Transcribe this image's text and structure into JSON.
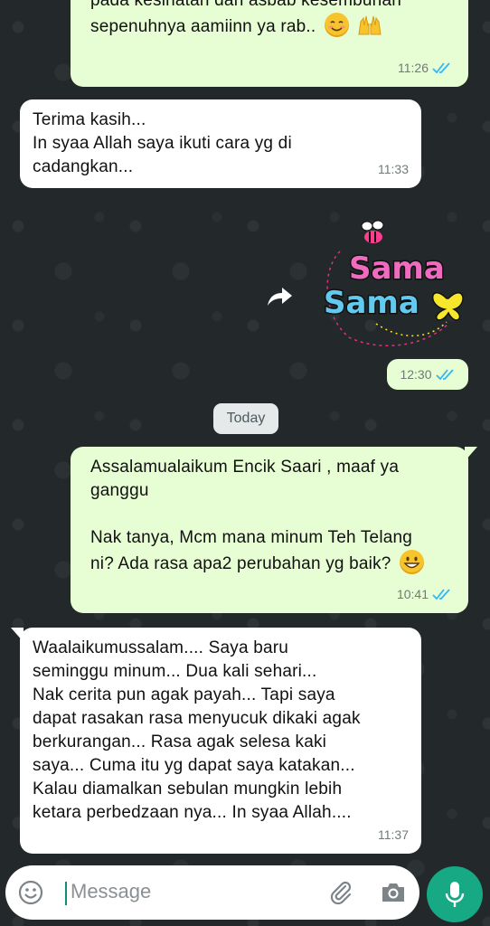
{
  "messages": [
    {
      "direction": "outgoing",
      "text": "pada kesihatan dan asbab kesembuhan\nsepenuhnya aamiinn ya rab..",
      "emoji": [
        "smiling-face-icon",
        "raising-hands-icon"
      ],
      "time": "11:26",
      "status": "read"
    },
    {
      "direction": "incoming",
      "text": "Terima kasih...\nIn syaa Allah saya ikuti cara yg di\ncadangkan...",
      "time": "11:33"
    },
    {
      "direction": "outgoing",
      "type": "sticker",
      "sticker_text_line1": "Sama",
      "sticker_text_line2": "Sama",
      "time": "12:30",
      "status": "read"
    },
    {
      "direction": "outgoing",
      "text": "Assalamualaikum Encik Saari , maaf ya\nganggu\n\nNak tanya, Mcm mana minum Teh Telang\nni? Ada rasa apa2 perubahan yg baik?",
      "emoji": [
        "grinning-face-icon"
      ],
      "time": "10:41",
      "status": "read"
    },
    {
      "direction": "incoming",
      "text": "Waalaikumussalam.... Saya baru\nseminggu minum... Dua kali sehari...\nNak cerita pun agak payah... Tapi saya\ndapat rasakan rasa menyucuk dikaki agak\nberkurangan... Rasa agak selesa kaki\nsaya... Cuma itu yg dapat saya katakan...\nKalau diamalkan sebulan mungkin lebih\nketara perbedzaan nya... In syaa Allah....",
      "time": "11:37"
    }
  ],
  "date_divider": "Today",
  "composer": {
    "placeholder": "Message"
  },
  "colors": {
    "outgoing_bubble": "#e7fdd3",
    "incoming_bubble": "#ffffff",
    "read_ticks": "#34b7f1",
    "mic_button": "#17a884"
  }
}
